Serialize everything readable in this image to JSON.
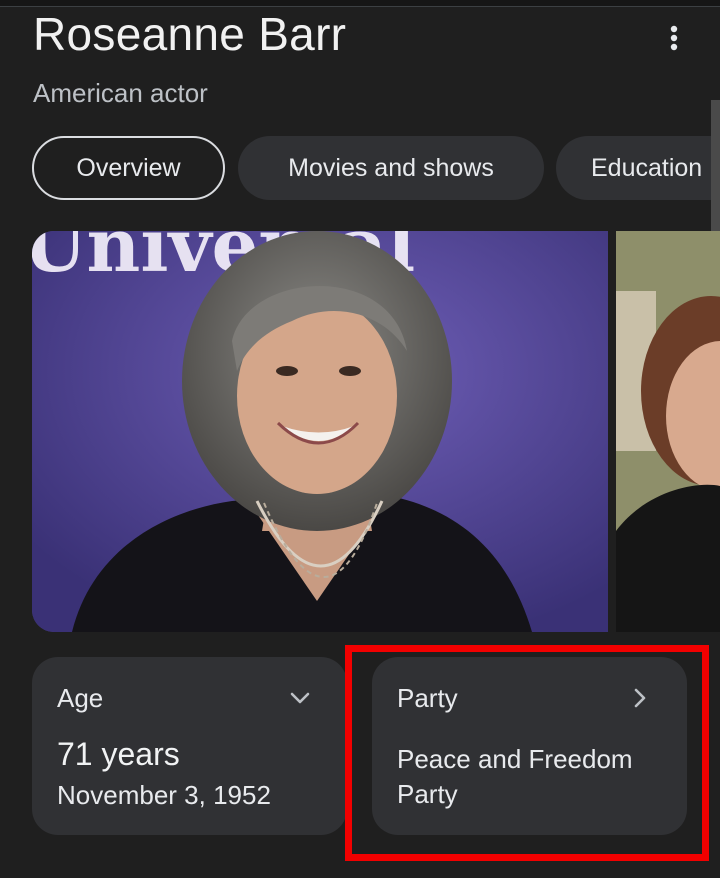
{
  "header": {
    "title": "Roseanne Barr",
    "subtitle": "American actor"
  },
  "tabs": [
    {
      "label": "Overview",
      "active": true
    },
    {
      "label": "Movies and shows",
      "active": false
    },
    {
      "label": "Education",
      "active": false
    }
  ],
  "photo": {
    "backdrop_text": "Universal"
  },
  "cards": {
    "age": {
      "label": "Age",
      "value": "71 years",
      "detail": "November 3, 1952",
      "icon": "chevron-down-icon"
    },
    "party": {
      "label": "Party",
      "value": "Peace and Freedom Party",
      "icon": "chevron-right-icon"
    }
  },
  "colors": {
    "background": "#1f1f1f",
    "chip": "#303134",
    "highlight": "#f20000"
  }
}
